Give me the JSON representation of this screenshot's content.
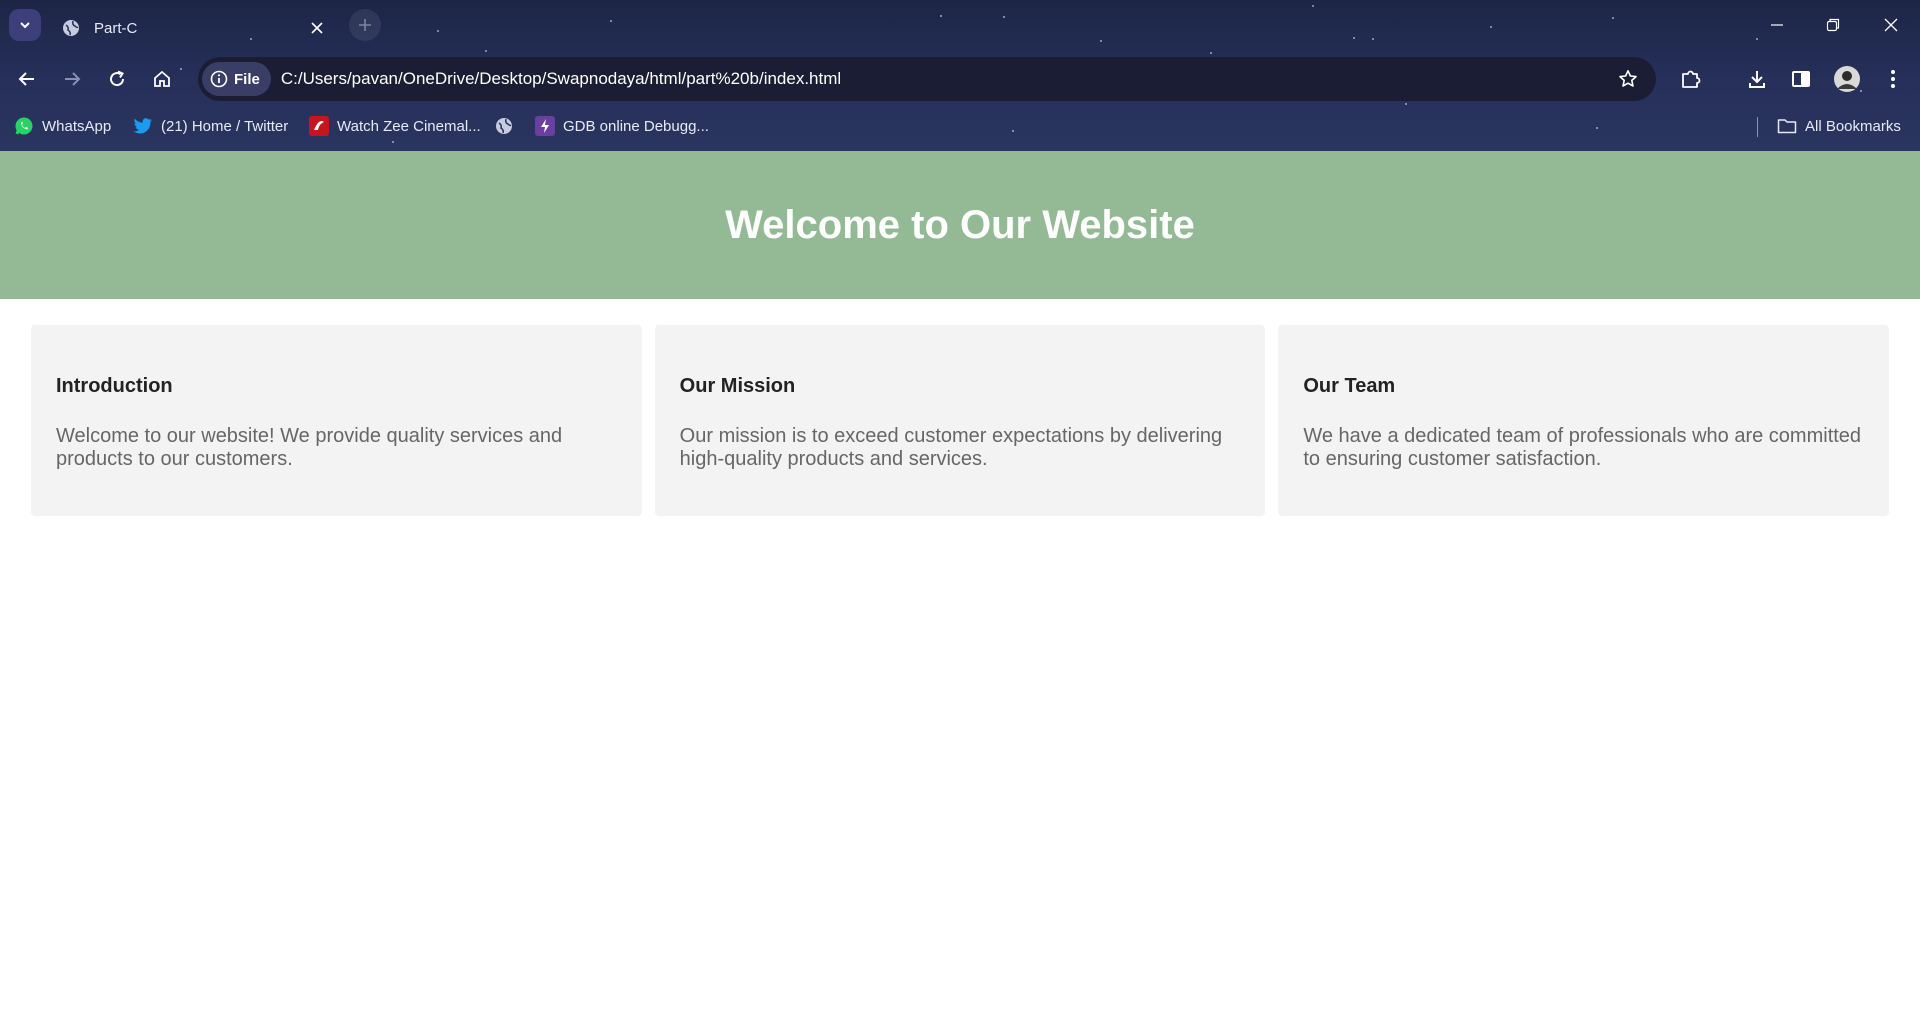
{
  "browser": {
    "tab": {
      "title": "Part-C"
    },
    "address": {
      "chip_label": "File",
      "url": "C:/Users/pavan/OneDrive/Desktop/Swapnodaya/html/part%20b/index.html"
    },
    "bookmarks": [
      {
        "label": "WhatsApp",
        "icon": "whatsapp-icon"
      },
      {
        "label": "(21) Home / Twitter",
        "icon": "twitter-icon"
      },
      {
        "label": "Watch Zee Cinemal...",
        "icon": "zee-icon"
      },
      {
        "label": "",
        "icon": "globe-icon"
      },
      {
        "label": "GDB online Debugg...",
        "icon": "gdb-icon"
      }
    ],
    "all_bookmarks_label": "All Bookmarks"
  },
  "page": {
    "header_title": "Welcome to Our Website",
    "sections": [
      {
        "heading": "Introduction",
        "text": "Welcome to our website! We provide quality services and products to our customers."
      },
      {
        "heading": "Our Mission",
        "text": "Our mission is to exceed customer expectations by delivering high-quality products and services."
      },
      {
        "heading": "Our Team",
        "text": "We have a dedicated team of professionals who are committed to ensuring customer satisfaction."
      }
    ]
  },
  "colors": {
    "header_bg": "#93b995",
    "card_bg": "#f3f3f3",
    "chrome_bg": "#1d2547"
  }
}
